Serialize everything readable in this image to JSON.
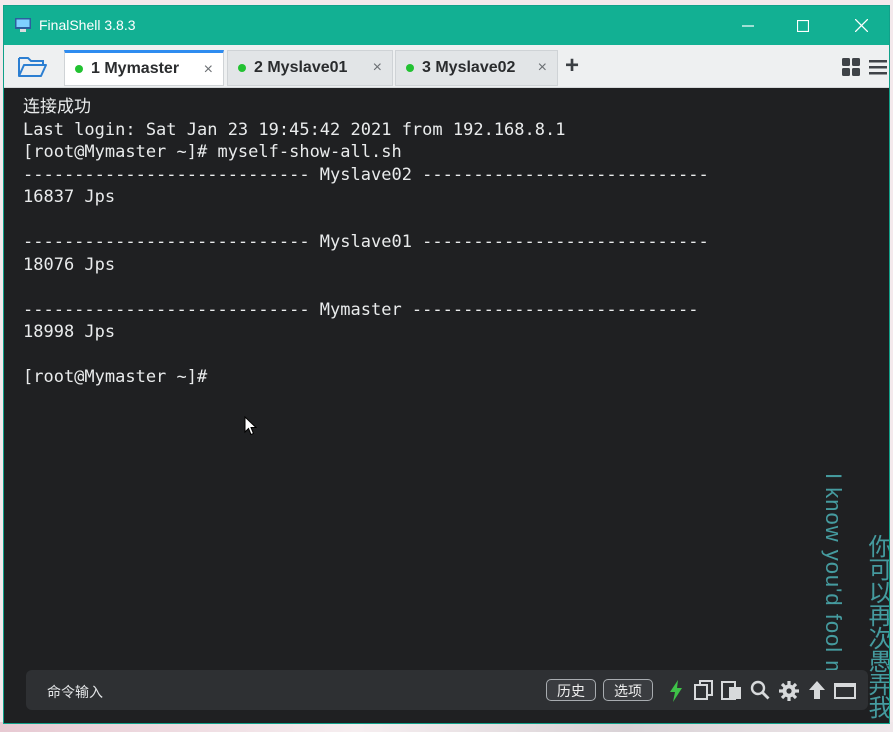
{
  "window": {
    "title": "FinalShell 3.8.3"
  },
  "tabs": [
    {
      "label": "1 Mymaster",
      "active": true
    },
    {
      "label": "2 Myslave01",
      "active": false
    },
    {
      "label": "3 Myslave02",
      "active": false
    }
  ],
  "tab_close_glyph": "×",
  "add_tab_glyph": "+",
  "terminal": {
    "lines": [
      "连接成功",
      "Last login: Sat Jan 23 19:45:42 2021 from 192.168.8.1",
      "[root@Mymaster ~]# myself-show-all.sh",
      "---------------------------- Myslave02 ----------------------------",
      "16837 Jps",
      "",
      "---------------------------- Myslave01 ----------------------------",
      "18076 Jps",
      "",
      "---------------------------- Mymaster ----------------------------",
      "18998 Jps",
      "",
      "[root@Mymaster ~]#"
    ]
  },
  "watermark": {
    "en": "I know you'd fool me",
    "cn": "你可以再次愚弄我"
  },
  "command_bar": {
    "placeholder": "命令输入",
    "history_button": "历史",
    "options_button": "选项"
  },
  "colors": {
    "titlebar": "#12b093",
    "terminal_bg": "#1f2022",
    "active_tab_accent": "#2f8cf0",
    "status_dot": "#22c232"
  }
}
